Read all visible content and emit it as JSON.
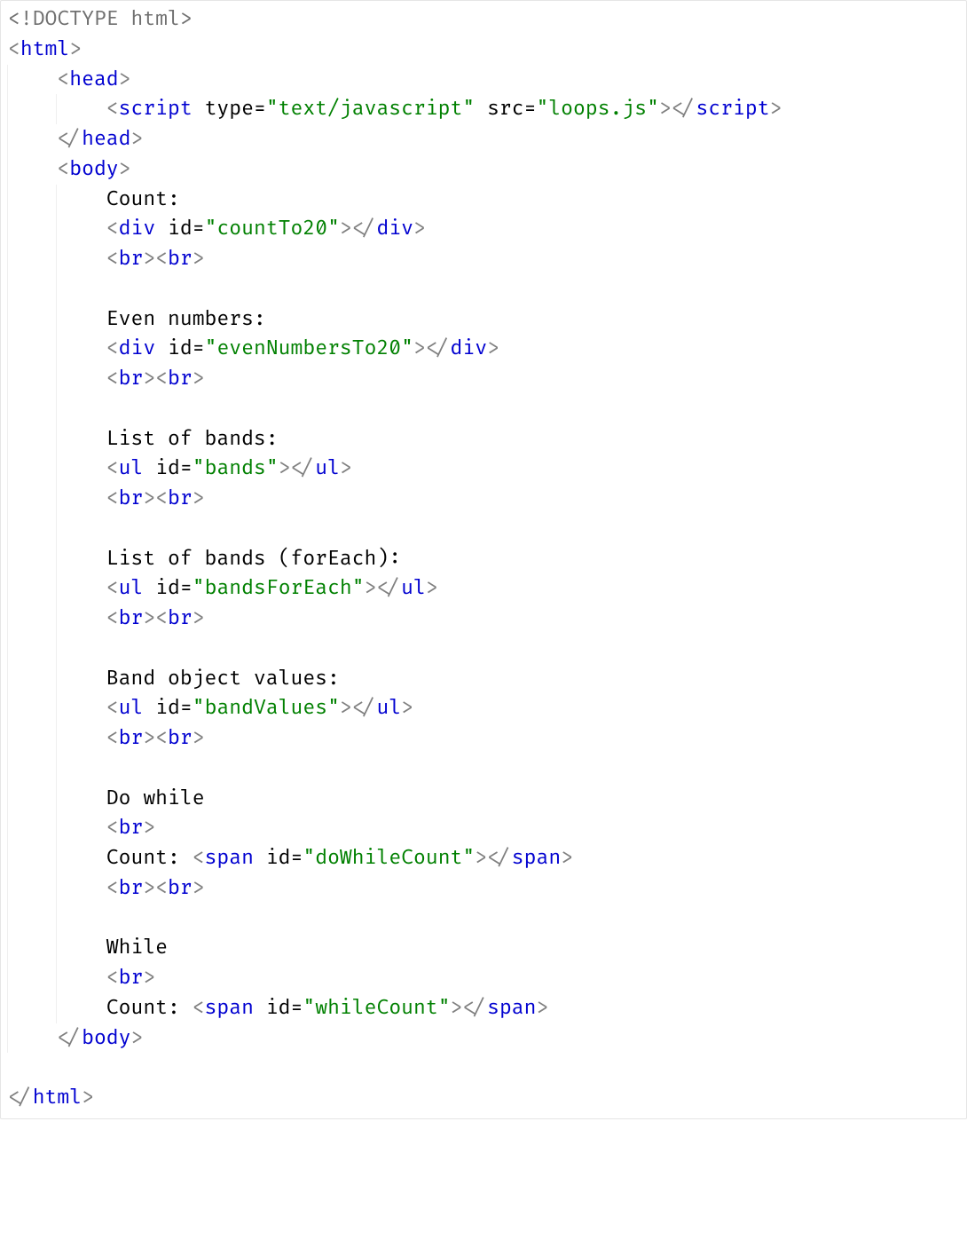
{
  "rows": [
    {
      "indent": 0,
      "spans": [
        {
          "c": "t-doctype",
          "t": "<!DOCTYPE html>"
        }
      ]
    },
    {
      "indent": 0,
      "spans": [
        {
          "c": "t-angle",
          "t": "<"
        },
        {
          "c": "t-tag",
          "t": "html"
        },
        {
          "c": "t-angle",
          "t": ">"
        }
      ]
    },
    {
      "indent": 1,
      "spans": [
        {
          "c": "t-angle",
          "t": "<"
        },
        {
          "c": "t-tag",
          "t": "head"
        },
        {
          "c": "t-angle",
          "t": ">"
        }
      ]
    },
    {
      "indent": 2,
      "spans": [
        {
          "c": "t-angle",
          "t": "<"
        },
        {
          "c": "t-tag",
          "t": "script"
        },
        {
          "c": "t-text",
          "t": " "
        },
        {
          "c": "t-attr",
          "t": "type"
        },
        {
          "c": "t-eq",
          "t": "="
        },
        {
          "c": "t-str",
          "t": "\"text/javascript\""
        },
        {
          "c": "t-text",
          "t": " "
        },
        {
          "c": "t-attr",
          "t": "src"
        },
        {
          "c": "t-eq",
          "t": "="
        },
        {
          "c": "t-str",
          "t": "\"loops.js\""
        },
        {
          "c": "t-angle",
          "t": "></"
        },
        {
          "c": "t-tag",
          "t": "script"
        },
        {
          "c": "t-angle",
          "t": ">"
        }
      ]
    },
    {
      "indent": 1,
      "spans": [
        {
          "c": "t-angle",
          "t": "</"
        },
        {
          "c": "t-tag",
          "t": "head"
        },
        {
          "c": "t-angle",
          "t": ">"
        }
      ]
    },
    {
      "indent": 1,
      "spans": [
        {
          "c": "t-angle",
          "t": "<"
        },
        {
          "c": "t-tag",
          "t": "body"
        },
        {
          "c": "t-angle",
          "t": ">"
        }
      ]
    },
    {
      "indent": 2,
      "spans": [
        {
          "c": "t-text",
          "t": "Count:"
        }
      ]
    },
    {
      "indent": 2,
      "spans": [
        {
          "c": "t-angle",
          "t": "<"
        },
        {
          "c": "t-tag",
          "t": "div"
        },
        {
          "c": "t-text",
          "t": " "
        },
        {
          "c": "t-attr",
          "t": "id"
        },
        {
          "c": "t-eq",
          "t": "="
        },
        {
          "c": "t-str",
          "t": "\"countTo20\""
        },
        {
          "c": "t-angle",
          "t": "></"
        },
        {
          "c": "t-tag",
          "t": "div"
        },
        {
          "c": "t-angle",
          "t": ">"
        }
      ]
    },
    {
      "indent": 2,
      "spans": [
        {
          "c": "t-angle",
          "t": "<"
        },
        {
          "c": "t-tag",
          "t": "br"
        },
        {
          "c": "t-angle",
          "t": "><"
        },
        {
          "c": "t-tag",
          "t": "br"
        },
        {
          "c": "t-angle",
          "t": ">"
        }
      ]
    },
    {
      "indent": 2,
      "spans": []
    },
    {
      "indent": 2,
      "spans": [
        {
          "c": "t-text",
          "t": "Even numbers:"
        }
      ]
    },
    {
      "indent": 2,
      "spans": [
        {
          "c": "t-angle",
          "t": "<"
        },
        {
          "c": "t-tag",
          "t": "div"
        },
        {
          "c": "t-text",
          "t": " "
        },
        {
          "c": "t-attr",
          "t": "id"
        },
        {
          "c": "t-eq",
          "t": "="
        },
        {
          "c": "t-str",
          "t": "\"evenNumbersTo20\""
        },
        {
          "c": "t-angle",
          "t": "></"
        },
        {
          "c": "t-tag",
          "t": "div"
        },
        {
          "c": "t-angle",
          "t": ">"
        }
      ]
    },
    {
      "indent": 2,
      "spans": [
        {
          "c": "t-angle",
          "t": "<"
        },
        {
          "c": "t-tag",
          "t": "br"
        },
        {
          "c": "t-angle",
          "t": "><"
        },
        {
          "c": "t-tag",
          "t": "br"
        },
        {
          "c": "t-angle",
          "t": ">"
        }
      ]
    },
    {
      "indent": 2,
      "spans": []
    },
    {
      "indent": 2,
      "spans": [
        {
          "c": "t-text",
          "t": "List of bands:"
        }
      ]
    },
    {
      "indent": 2,
      "spans": [
        {
          "c": "t-angle",
          "t": "<"
        },
        {
          "c": "t-tag",
          "t": "ul"
        },
        {
          "c": "t-text",
          "t": " "
        },
        {
          "c": "t-attr",
          "t": "id"
        },
        {
          "c": "t-eq",
          "t": "="
        },
        {
          "c": "t-str",
          "t": "\"bands\""
        },
        {
          "c": "t-angle",
          "t": "></"
        },
        {
          "c": "t-tag",
          "t": "ul"
        },
        {
          "c": "t-angle",
          "t": ">"
        }
      ]
    },
    {
      "indent": 2,
      "spans": [
        {
          "c": "t-angle",
          "t": "<"
        },
        {
          "c": "t-tag",
          "t": "br"
        },
        {
          "c": "t-angle",
          "t": "><"
        },
        {
          "c": "t-tag",
          "t": "br"
        },
        {
          "c": "t-angle",
          "t": ">"
        }
      ]
    },
    {
      "indent": 2,
      "spans": []
    },
    {
      "indent": 2,
      "spans": [
        {
          "c": "t-text",
          "t": "List of bands (forEach):"
        }
      ]
    },
    {
      "indent": 2,
      "spans": [
        {
          "c": "t-angle",
          "t": "<"
        },
        {
          "c": "t-tag",
          "t": "ul"
        },
        {
          "c": "t-text",
          "t": " "
        },
        {
          "c": "t-attr",
          "t": "id"
        },
        {
          "c": "t-eq",
          "t": "="
        },
        {
          "c": "t-str",
          "t": "\"bandsForEach\""
        },
        {
          "c": "t-angle",
          "t": "></"
        },
        {
          "c": "t-tag",
          "t": "ul"
        },
        {
          "c": "t-angle",
          "t": ">"
        }
      ]
    },
    {
      "indent": 2,
      "spans": [
        {
          "c": "t-angle",
          "t": "<"
        },
        {
          "c": "t-tag",
          "t": "br"
        },
        {
          "c": "t-angle",
          "t": "><"
        },
        {
          "c": "t-tag",
          "t": "br"
        },
        {
          "c": "t-angle",
          "t": ">"
        }
      ]
    },
    {
      "indent": 2,
      "spans": []
    },
    {
      "indent": 2,
      "spans": [
        {
          "c": "t-text",
          "t": "Band object values:"
        }
      ]
    },
    {
      "indent": 2,
      "spans": [
        {
          "c": "t-angle",
          "t": "<"
        },
        {
          "c": "t-tag",
          "t": "ul"
        },
        {
          "c": "t-text",
          "t": " "
        },
        {
          "c": "t-attr",
          "t": "id"
        },
        {
          "c": "t-eq",
          "t": "="
        },
        {
          "c": "t-str",
          "t": "\"bandValues\""
        },
        {
          "c": "t-angle",
          "t": "></"
        },
        {
          "c": "t-tag",
          "t": "ul"
        },
        {
          "c": "t-angle",
          "t": ">"
        }
      ]
    },
    {
      "indent": 2,
      "spans": [
        {
          "c": "t-angle",
          "t": "<"
        },
        {
          "c": "t-tag",
          "t": "br"
        },
        {
          "c": "t-angle",
          "t": "><"
        },
        {
          "c": "t-tag",
          "t": "br"
        },
        {
          "c": "t-angle",
          "t": ">"
        }
      ]
    },
    {
      "indent": 2,
      "spans": []
    },
    {
      "indent": 2,
      "spans": [
        {
          "c": "t-text",
          "t": "Do while"
        }
      ]
    },
    {
      "indent": 2,
      "spans": [
        {
          "c": "t-angle",
          "t": "<"
        },
        {
          "c": "t-tag",
          "t": "br"
        },
        {
          "c": "t-angle",
          "t": ">"
        }
      ]
    },
    {
      "indent": 2,
      "spans": [
        {
          "c": "t-text",
          "t": "Count: "
        },
        {
          "c": "t-angle",
          "t": "<"
        },
        {
          "c": "t-tag",
          "t": "span"
        },
        {
          "c": "t-text",
          "t": " "
        },
        {
          "c": "t-attr",
          "t": "id"
        },
        {
          "c": "t-eq",
          "t": "="
        },
        {
          "c": "t-str",
          "t": "\"doWhileCount\""
        },
        {
          "c": "t-angle",
          "t": "></"
        },
        {
          "c": "t-tag",
          "t": "span"
        },
        {
          "c": "t-angle",
          "t": ">"
        }
      ]
    },
    {
      "indent": 2,
      "spans": [
        {
          "c": "t-angle",
          "t": "<"
        },
        {
          "c": "t-tag",
          "t": "br"
        },
        {
          "c": "t-angle",
          "t": "><"
        },
        {
          "c": "t-tag",
          "t": "br"
        },
        {
          "c": "t-angle",
          "t": ">"
        }
      ]
    },
    {
      "indent": 2,
      "spans": []
    },
    {
      "indent": 2,
      "spans": [
        {
          "c": "t-text",
          "t": "While"
        }
      ]
    },
    {
      "indent": 2,
      "spans": [
        {
          "c": "t-angle",
          "t": "<"
        },
        {
          "c": "t-tag",
          "t": "br"
        },
        {
          "c": "t-angle",
          "t": ">"
        }
      ]
    },
    {
      "indent": 2,
      "spans": [
        {
          "c": "t-text",
          "t": "Count: "
        },
        {
          "c": "t-angle",
          "t": "<"
        },
        {
          "c": "t-tag",
          "t": "span"
        },
        {
          "c": "t-text",
          "t": " "
        },
        {
          "c": "t-attr",
          "t": "id"
        },
        {
          "c": "t-eq",
          "t": "="
        },
        {
          "c": "t-str",
          "t": "\"whileCount\""
        },
        {
          "c": "t-angle",
          "t": "></"
        },
        {
          "c": "t-tag",
          "t": "span"
        },
        {
          "c": "t-angle",
          "t": ">"
        }
      ]
    },
    {
      "indent": 1,
      "spans": [
        {
          "c": "t-angle",
          "t": "</"
        },
        {
          "c": "t-tag",
          "t": "body"
        },
        {
          "c": "t-angle",
          "t": ">"
        }
      ]
    },
    {
      "indent": 0,
      "spans": []
    },
    {
      "indent": 0,
      "spans": [
        {
          "c": "t-angle",
          "t": "</"
        },
        {
          "c": "t-tag",
          "t": "html"
        },
        {
          "c": "t-angle",
          "t": ">"
        }
      ]
    }
  ],
  "indentUnit": "    "
}
